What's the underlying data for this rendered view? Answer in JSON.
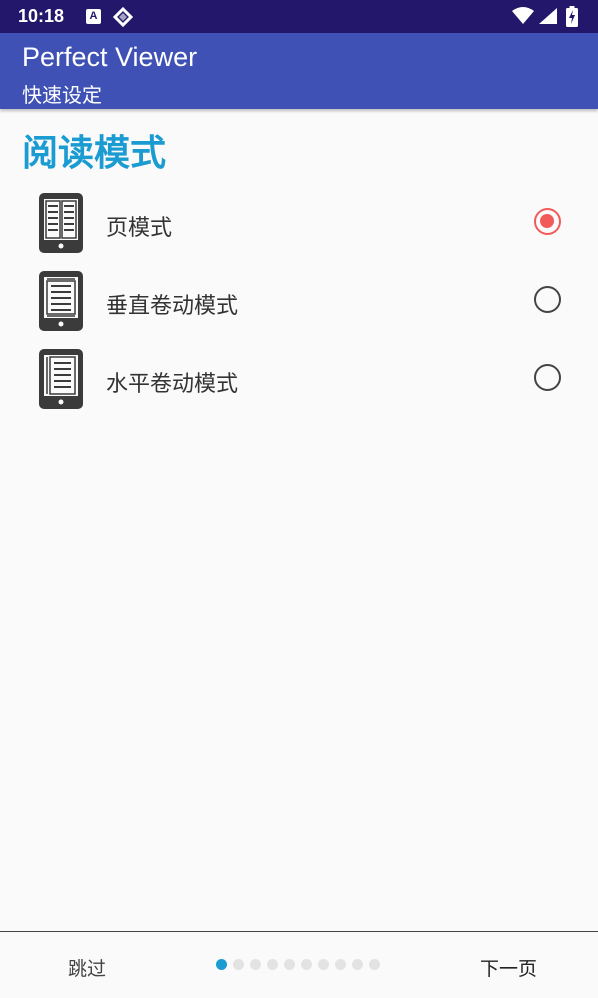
{
  "status_bar": {
    "time": "10:18",
    "notification_letter": "A"
  },
  "app_bar": {
    "title": "Perfect Viewer",
    "subtitle": "快速设定"
  },
  "section": {
    "title": "阅读模式"
  },
  "modes": [
    {
      "label": "页模式",
      "icon": "tablet-page-icon",
      "selected": true
    },
    {
      "label": "垂直卷动模式",
      "icon": "tablet-vertical-scroll-icon",
      "selected": false
    },
    {
      "label": "水平卷动模式",
      "icon": "tablet-horizontal-scroll-icon",
      "selected": false
    }
  ],
  "footer": {
    "skip_label": "跳过",
    "next_label": "下一页",
    "page_count": 10,
    "current_page": 1
  },
  "colors": {
    "status_bar": "#23176b",
    "app_bar": "#3f51b5",
    "accent": "#1a9bd1",
    "radio_selected": "#f25a5a"
  }
}
